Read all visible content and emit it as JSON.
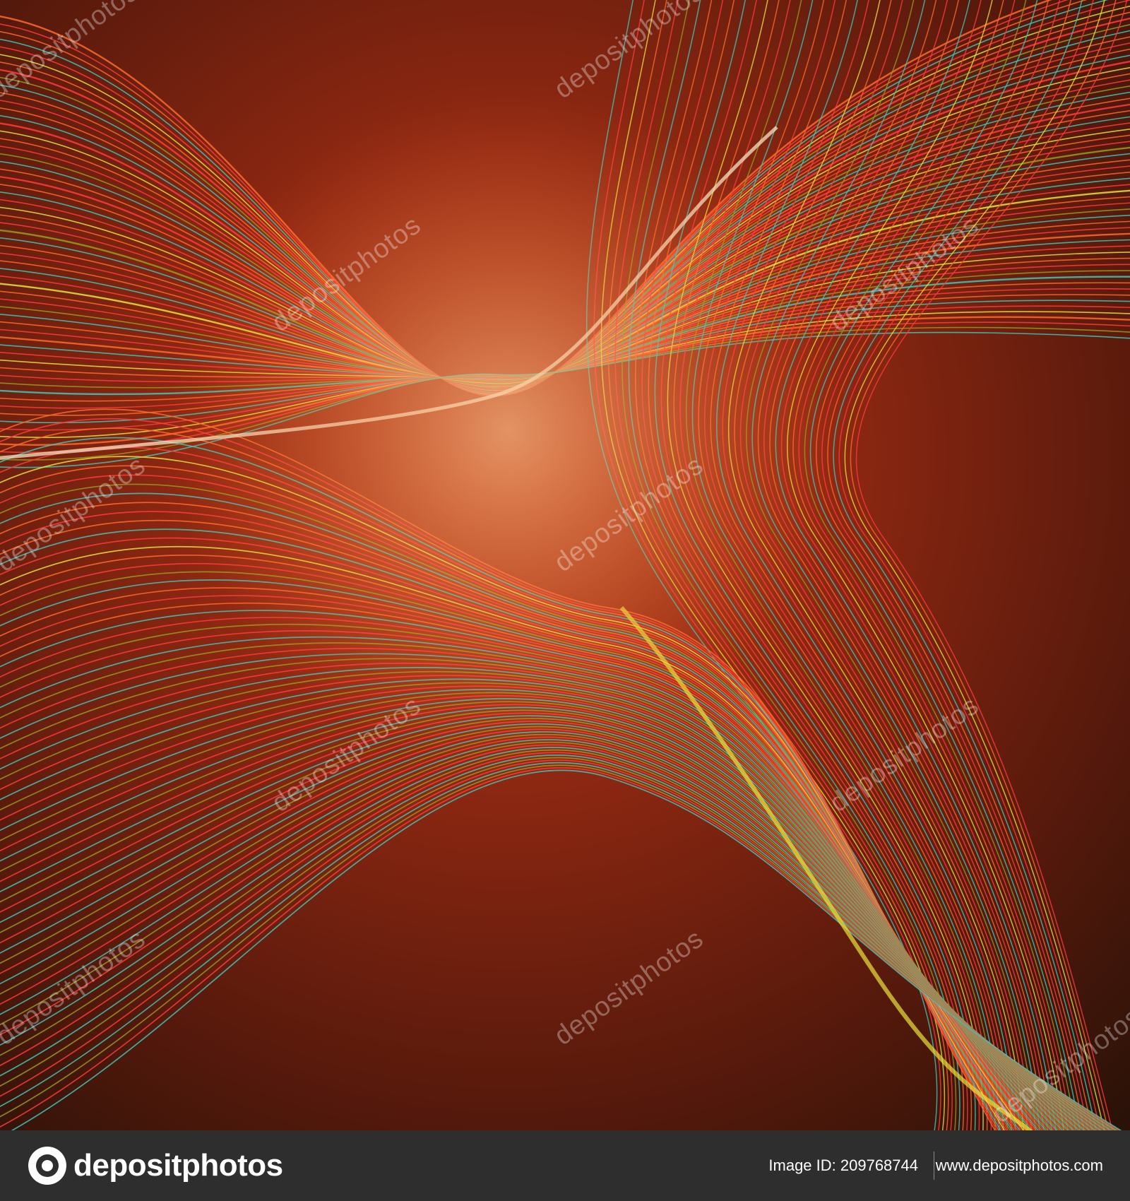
{
  "watermark": {
    "text": "depositphotos"
  },
  "footer": {
    "logo_text": "depositphotos",
    "image_id": "Image ID: 209768744",
    "site_url": "www.depositphotos.com"
  },
  "colors": {
    "background_dark": "#2b1208",
    "deep_red": "#8a1a10",
    "orange": "#ff6a2a",
    "red": "#ff3b3b",
    "yellow": "#e8e23a",
    "teal": "#3fc7b6",
    "olive": "#9a9a20",
    "footer_bg": "#2e2e2e"
  }
}
